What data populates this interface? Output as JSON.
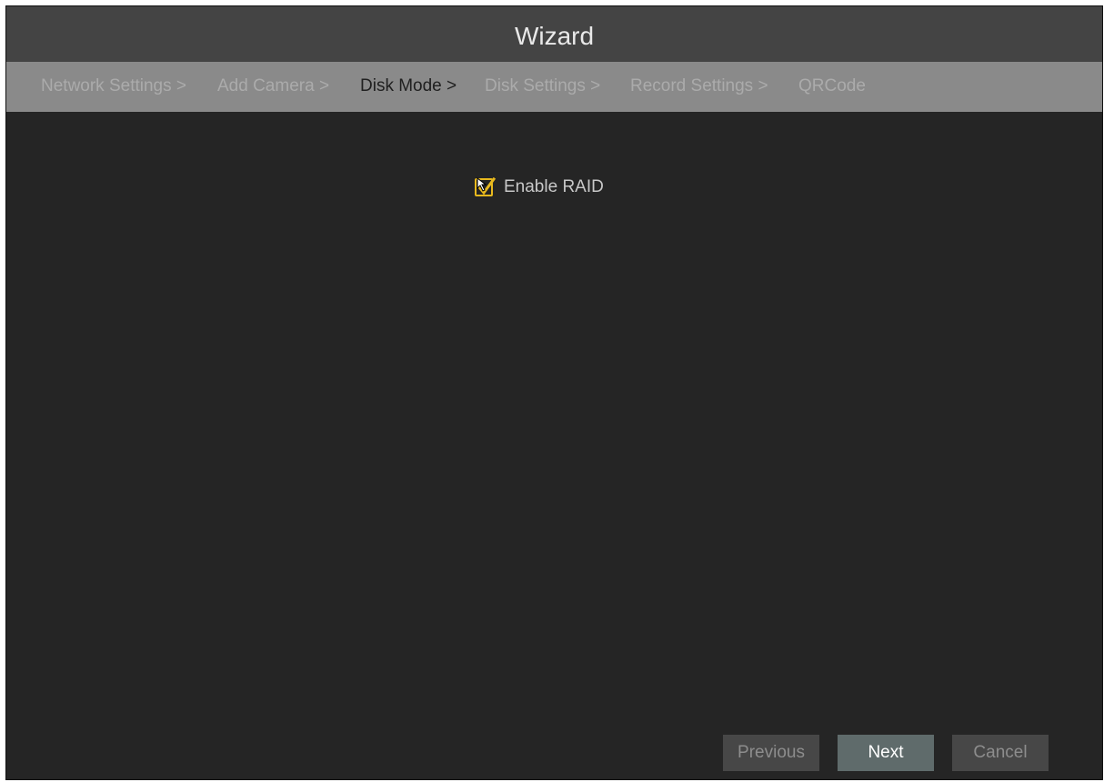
{
  "window": {
    "title": "Wizard"
  },
  "steps": [
    {
      "label": "Network Settings >",
      "active": false
    },
    {
      "label": "Add Camera >",
      "active": false
    },
    {
      "label": "Disk Mode >",
      "active": true
    },
    {
      "label": "Disk Settings >",
      "active": false
    },
    {
      "label": "Record Settings >",
      "active": false
    },
    {
      "label": "QRCode",
      "active": false
    }
  ],
  "disk_mode": {
    "enable_raid_label": "Enable RAID",
    "enable_raid_checked": true
  },
  "buttons": {
    "previous_label": "Previous",
    "next_label": "Next",
    "cancel_label": "Cancel"
  },
  "colors": {
    "accent": "#e8b91e",
    "background": "#252525",
    "title_bar": "#444444",
    "steps_bar": "#8a8a8a"
  },
  "icons": {
    "checkbox_check": "checkmark-icon",
    "mouse_cursor": "pointer-cursor-icon"
  }
}
